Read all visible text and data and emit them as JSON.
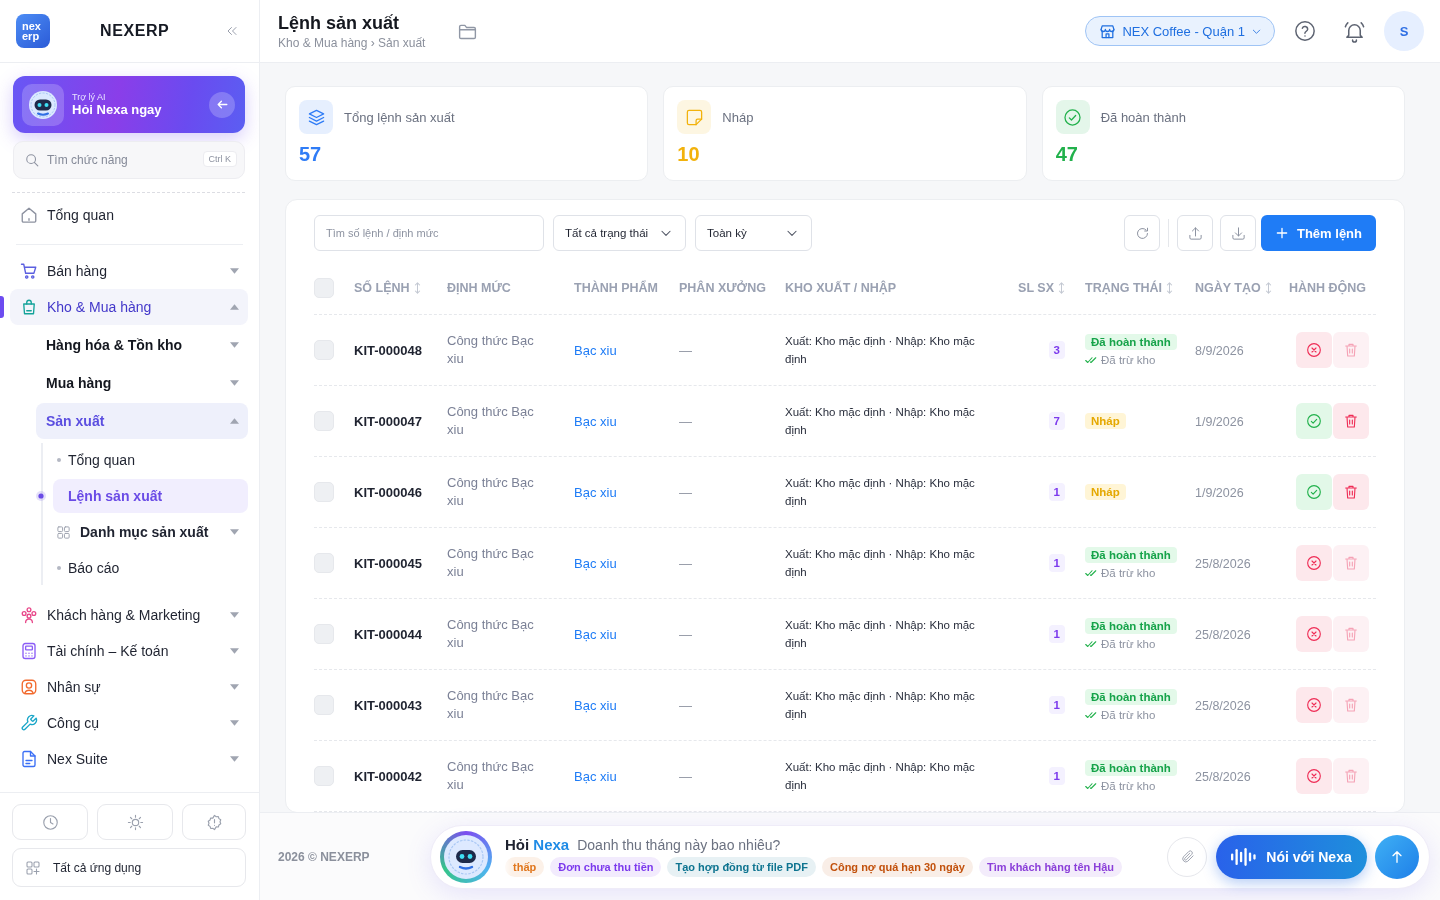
{
  "sidebar": {
    "logo": {
      "mark": [
        "nex",
        "erp"
      ],
      "name": "NEXERP"
    },
    "assistant_card": {
      "caption": "Trợ lý AI",
      "title": "Hỏi Nexa ngay"
    },
    "search": {
      "placeholder": "Tìm chức năng",
      "shortcut": "Ctrl K"
    },
    "nav_top": [
      {
        "label": "Tổng quan",
        "selected": false
      }
    ],
    "nav": [
      {
        "label": "Bán hàng",
        "expanded": false,
        "selected": false
      },
      {
        "label": "Kho & Mua hàng",
        "expanded": true,
        "selected": true,
        "children": [
          {
            "label": "Hàng hóa & Tồn kho",
            "expanded": false,
            "selected": false
          },
          {
            "label": "Mua hàng",
            "expanded": false,
            "selected": false
          },
          {
            "label": "Sản xuất",
            "expanded": true,
            "selected": true,
            "children": [
              {
                "kind": "page",
                "label": "Tổng quan",
                "selected": false
              },
              {
                "kind": "page",
                "label": "Lệnh sản xuất",
                "selected": true
              },
              {
                "kind": "group",
                "label": "Danh mục sản xuất",
                "expanded": false,
                "selected": false
              },
              {
                "kind": "page",
                "label": "Báo cáo",
                "selected": false
              }
            ]
          }
        ]
      },
      {
        "label": "Khách hàng & Marketing",
        "expanded": false,
        "selected": false
      },
      {
        "label": "Tài chính – Kế toán",
        "expanded": false,
        "selected": false
      },
      {
        "label": "Nhân sự",
        "expanded": false,
        "selected": false
      },
      {
        "label": "Công cụ",
        "expanded": false,
        "selected": false
      },
      {
        "label": "Nex Suite",
        "expanded": false,
        "selected": false
      }
    ],
    "all_apps": "Tất cả ứng dụng"
  },
  "header": {
    "title": "Lệnh sản xuất",
    "breadcrumb": "Kho & Mua hàng › Sản xuất",
    "store": "NEX Coffee - Quận 1",
    "avatar": "S"
  },
  "stats": [
    {
      "label": "Tổng lệnh sản xuất",
      "value": "57",
      "color": "#2f7cf6"
    },
    {
      "label": "Nháp",
      "value": "10",
      "color": "#f2b20c"
    },
    {
      "label": "Đã hoàn thành",
      "value": "47",
      "color": "#22b14c"
    }
  ],
  "toolbar": {
    "search": {
      "placeholder": "Tìm số lệnh / định mức"
    },
    "filters": [
      {
        "value": "Tất cả trạng thái"
      },
      {
        "value": "Toàn kỳ"
      }
    ],
    "add_button": "Thêm lệnh"
  },
  "table": {
    "select_all": {
      "checked": false
    },
    "columns": [
      {
        "label": "SỐ LỆNH",
        "sortable": true
      },
      {
        "label": "ĐỊNH MỨC",
        "sortable": false
      },
      {
        "label": "THÀNH PHẨM",
        "sortable": false
      },
      {
        "label": "PHÂN XƯỞNG",
        "sortable": false
      },
      {
        "label": "KHO XUẤT / NHẬP",
        "sortable": false
      },
      {
        "label": "SL SX",
        "sortable": true
      },
      {
        "label": "TRẠNG THÁI",
        "sortable": true
      },
      {
        "label": "NGÀY TẠO",
        "sortable": true
      },
      {
        "label": "HÀNH ĐỘNG",
        "sortable": false
      }
    ],
    "rows": [
      {
        "checked": false,
        "number": "KIT-000048",
        "formula": "Công thức Bạc xiu",
        "product": "Bạc xiu",
        "workshop": "—",
        "warehouse": "Xuất: Kho mặc định · Nhập: Kho mặc định",
        "quantity": "3",
        "status": {
          "kind": "done",
          "label": "Đã hoàn thành",
          "note": "Đã trừ kho"
        },
        "created": "8/9/2026",
        "actions": [
          {
            "kind": "cancel",
            "disabled": false
          },
          {
            "kind": "delete",
            "disabled": true
          }
        ]
      },
      {
        "checked": false,
        "number": "KIT-000047",
        "formula": "Công thức Bạc xiu",
        "product": "Bạc xiu",
        "workshop": "—",
        "warehouse": "Xuất: Kho mặc định · Nhập: Kho mặc định",
        "quantity": "7",
        "status": {
          "kind": "draft",
          "label": "Nháp"
        },
        "created": "1/9/2026",
        "actions": [
          {
            "kind": "approve",
            "disabled": false
          },
          {
            "kind": "delete",
            "disabled": false
          }
        ]
      },
      {
        "checked": false,
        "number": "KIT-000046",
        "formula": "Công thức Bạc xiu",
        "product": "Bạc xiu",
        "workshop": "—",
        "warehouse": "Xuất: Kho mặc định · Nhập: Kho mặc định",
        "quantity": "1",
        "status": {
          "kind": "draft",
          "label": "Nháp"
        },
        "created": "1/9/2026",
        "actions": [
          {
            "kind": "approve",
            "disabled": false
          },
          {
            "kind": "delete",
            "disabled": false
          }
        ]
      },
      {
        "checked": false,
        "number": "KIT-000045",
        "formula": "Công thức Bạc xiu",
        "product": "Bạc xiu",
        "workshop": "—",
        "warehouse": "Xuất: Kho mặc định · Nhập: Kho mặc định",
        "quantity": "1",
        "status": {
          "kind": "done",
          "label": "Đã hoàn thành",
          "note": "Đã trừ kho"
        },
        "created": "25/8/2026",
        "actions": [
          {
            "kind": "cancel",
            "disabled": false
          },
          {
            "kind": "delete",
            "disabled": true
          }
        ]
      },
      {
        "checked": false,
        "number": "KIT-000044",
        "formula": "Công thức Bạc xiu",
        "product": "Bạc xiu",
        "workshop": "—",
        "warehouse": "Xuất: Kho mặc định · Nhập: Kho mặc định",
        "quantity": "1",
        "status": {
          "kind": "done",
          "label": "Đã hoàn thành",
          "note": "Đã trừ kho"
        },
        "created": "25/8/2026",
        "actions": [
          {
            "kind": "cancel",
            "disabled": false
          },
          {
            "kind": "delete",
            "disabled": true
          }
        ]
      },
      {
        "checked": false,
        "number": "KIT-000043",
        "formula": "Công thức Bạc xiu",
        "product": "Bạc xiu",
        "workshop": "—",
        "warehouse": "Xuất: Kho mặc định · Nhập: Kho mặc định",
        "quantity": "1",
        "status": {
          "kind": "done",
          "label": "Đã hoàn thành",
          "note": "Đã trừ kho"
        },
        "created": "25/8/2026",
        "actions": [
          {
            "kind": "cancel",
            "disabled": false
          },
          {
            "kind": "delete",
            "disabled": true
          }
        ]
      },
      {
        "checked": false,
        "number": "KIT-000042",
        "formula": "Công thức Bạc xiu",
        "product": "Bạc xiu",
        "workshop": "—",
        "warehouse": "Xuất: Kho mặc định · Nhập: Kho mặc định",
        "quantity": "1",
        "status": {
          "kind": "done",
          "label": "Đã hoàn thành",
          "note": "Đã trừ kho"
        },
        "created": "25/8/2026",
        "actions": [
          {
            "kind": "cancel",
            "disabled": false
          },
          {
            "kind": "delete",
            "disabled": true
          }
        ]
      }
    ]
  },
  "footer": {
    "copyright": "2026 © NEXERP",
    "assistant": {
      "title_prefix": "Hỏi",
      "title_highlight": "Nexa",
      "placeholder": "Doanh thu tháng này bao nhiêu?",
      "suggestions": [
        {
          "label": "thấp",
          "color": "#e0761c"
        },
        {
          "label": "Đơn chưa thu tiền",
          "color": "#7c3aed"
        },
        {
          "label": "Tạo hợp đồng từ file PDF",
          "color": "#0e7490"
        },
        {
          "label": "Công nợ quá hạn 30 ngày",
          "color": "#c2510c"
        },
        {
          "label": "Tìm khách hàng tên Hậu",
          "color": "#8b3fd9"
        }
      ],
      "voice_button": "Nói với Nexa"
    }
  }
}
